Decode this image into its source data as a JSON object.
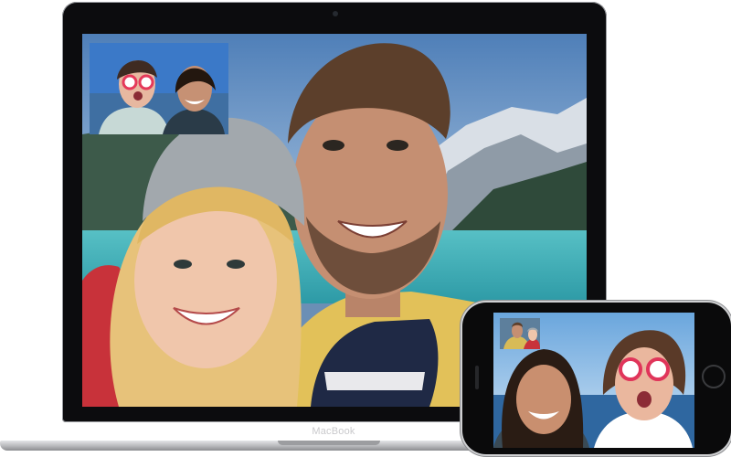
{
  "macbook": {
    "label": "MacBook",
    "call": {
      "remote_video": "facetime-remote-video",
      "self_view": "facetime-self-view"
    }
  },
  "iphone": {
    "call": {
      "remote_video": "facetime-remote-video",
      "self_view": "facetime-self-view"
    }
  },
  "colors": {
    "device_black": "#0c0c0e",
    "aluminum": "#c4c5c8",
    "lake": "#4cb7bf",
    "sky": "#6b8fb5"
  }
}
